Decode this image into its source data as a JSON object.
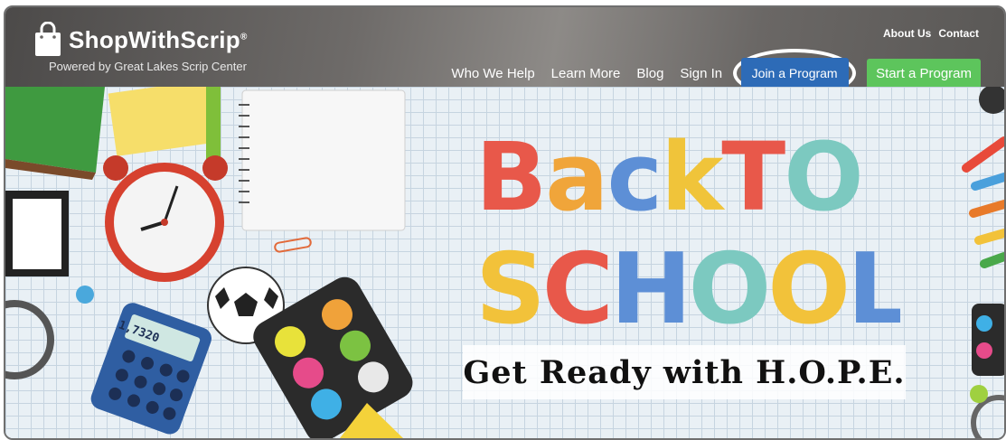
{
  "brand": {
    "name": "ShopWithScrip",
    "trademark": "®",
    "subtitle": "Powered by Great Lakes Scrip Center"
  },
  "top_links": [
    "About Us",
    "Contact"
  ],
  "nav": {
    "links": [
      "Who We Help",
      "Learn More",
      "Blog",
      "Sign In"
    ],
    "join_button": "Join a Program",
    "start_button": "Start a Program"
  },
  "hero": {
    "title_line1": "BackTO",
    "title_line2": "SCHOOL",
    "tagline": "Get Ready with H.O.P.E.",
    "calculator_display": "1,7320"
  },
  "colors": {
    "join_button": "#2d6bb7",
    "start_button": "#5dc55c"
  }
}
